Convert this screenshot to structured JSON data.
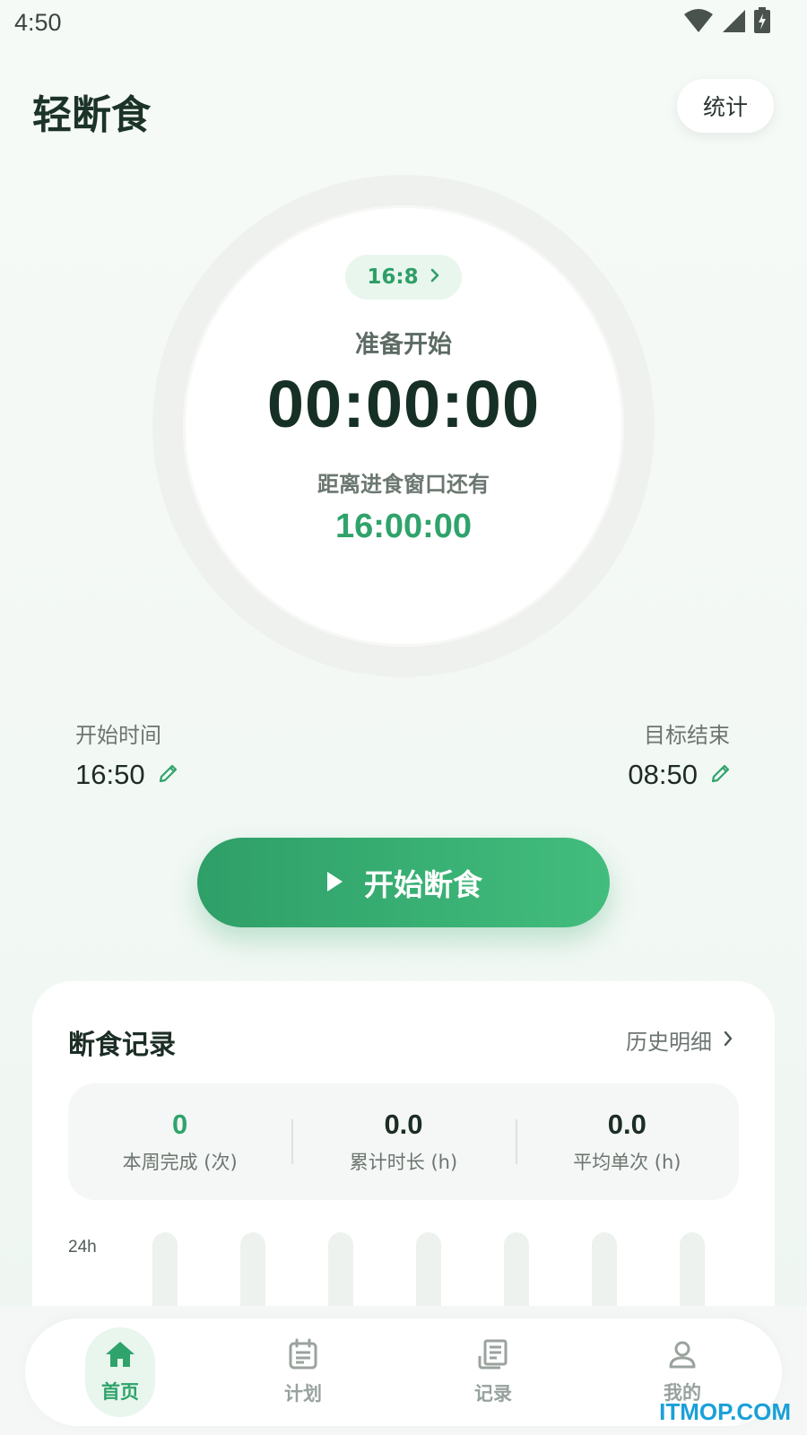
{
  "status_bar": {
    "time": "4:50"
  },
  "header": {
    "title": "轻断食",
    "stats_button": "统计"
  },
  "ring": {
    "plan": "16:8",
    "status": "准备开始",
    "elapsed": "00:00:00",
    "subtitle": "距离进食窗口还有",
    "remaining": "16:00:00",
    "progress": 0
  },
  "times": {
    "start_label": "开始时间",
    "start_value": "16:50",
    "end_label": "目标结束",
    "end_value": "08:50"
  },
  "start_button": {
    "label": "开始断食"
  },
  "records": {
    "title": "断食记录",
    "history_link": "历史明细",
    "stats": [
      {
        "value": "0",
        "label": "本周完成 (次)"
      },
      {
        "value": "0.0",
        "label": "累计时长 (h)"
      },
      {
        "value": "0.0",
        "label": "平均单次 (h)"
      }
    ],
    "axis_max_label": "24h"
  },
  "nav": {
    "items": [
      {
        "label": "首页",
        "icon": "home-icon",
        "active": true
      },
      {
        "label": "计划",
        "icon": "calendar-icon",
        "active": false
      },
      {
        "label": "记录",
        "icon": "receipt-icon",
        "active": false
      },
      {
        "label": "我的",
        "icon": "user-icon",
        "active": false
      }
    ]
  },
  "watermark": "ITMOP.COM",
  "colors": {
    "accent": "#2fa36b",
    "accent_light": "#e8f6ed",
    "text_dark": "#1c2d25"
  }
}
